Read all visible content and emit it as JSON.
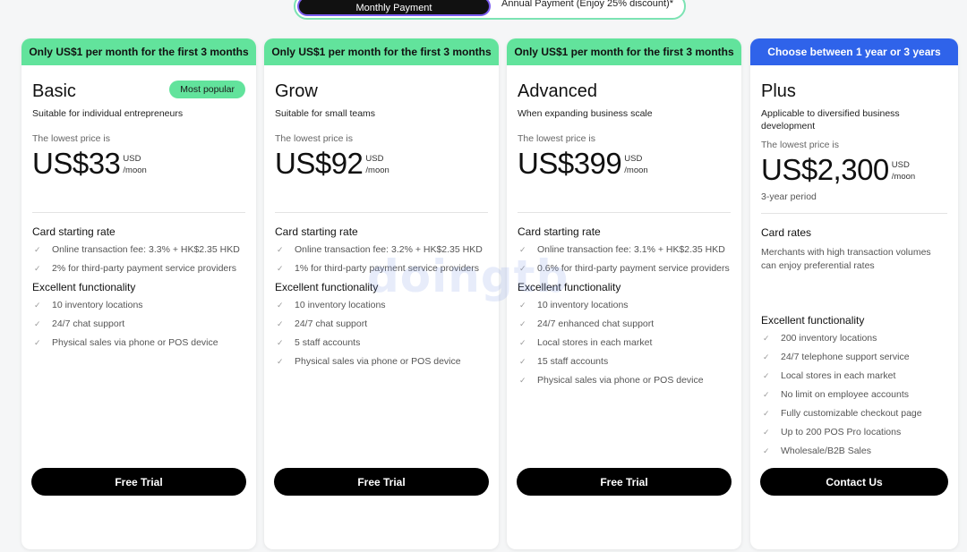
{
  "toggle": {
    "monthly": "Monthly Payment",
    "annual": "Annual Payment (Enjoy 25% discount)*"
  },
  "plans": [
    {
      "banner": "Only US$1 per month for the first 3 months",
      "name": "Basic",
      "badge": "Most popular",
      "desc": "Suitable for individual entrepreneurs",
      "lowest": "The lowest price is",
      "price": "US$33",
      "unit_a": "USD",
      "unit_b": "/moon",
      "rates_title": "Card starting rate",
      "rates": [
        "Online transaction fee: 3.3% + HK$2.35 HKD",
        "2% for third-party payment service providers"
      ],
      "func_title": "Excellent functionality",
      "features": [
        "10 inventory locations",
        "24/7 chat support",
        "Physical sales via phone or POS device"
      ],
      "button": "Free Trial"
    },
    {
      "banner": "Only US$1 per month for the first 3 months",
      "name": "Grow",
      "desc": "Suitable for small teams",
      "lowest": "The lowest price is",
      "price": "US$92",
      "unit_a": "USD",
      "unit_b": "/moon",
      "rates_title": "Card starting rate",
      "rates": [
        "Online transaction fee: 3.2% + HK$2.35 HKD",
        "1% for third-party payment service providers"
      ],
      "func_title": "Excellent functionality",
      "features": [
        "10 inventory locations",
        "24/7 chat support",
        "5 staff accounts",
        "Physical sales via phone or POS device"
      ],
      "button": "Free Trial"
    },
    {
      "banner": "Only US$1 per month for the first 3 months",
      "name": "Advanced",
      "desc": "When expanding business scale",
      "lowest": "The lowest price is",
      "price": "US$399",
      "unit_a": "USD",
      "unit_b": "/moon",
      "rates_title": "Card starting rate",
      "rates": [
        "Online transaction fee: 3.1% + HK$2.35 HKD",
        "0.6% for third-party payment service providers"
      ],
      "func_title": "Excellent functionality",
      "features": [
        "10 inventory locations",
        "24/7 enhanced chat support",
        "Local stores in each market",
        "15 staff accounts",
        "Physical sales via phone or POS device"
      ],
      "button": "Free Trial"
    },
    {
      "banner": "Choose between 1 year or 3 years",
      "name": "Plus",
      "desc": "Applicable to diversified business development",
      "lowest": "The lowest price is",
      "price": "US$2,300",
      "unit_a": "USD",
      "unit_b": "/moon",
      "period": "3-year period",
      "rates_title": "Card rates",
      "rates_text": "Merchants with high transaction volumes can enjoy preferential rates",
      "func_title": "Excellent functionality",
      "features": [
        "200 inventory locations",
        "24/7 telephone support service",
        "Local stores in each market",
        "No limit on employee accounts",
        "Fully customizable checkout page",
        "Up to 200 POS Pro locations",
        "Wholesale/B2B Sales"
      ],
      "button": "Contact Us"
    }
  ],
  "watermark": "doingtb",
  "colors": {
    "banner_green": "#62e39c",
    "banner_blue": "#2f63ea",
    "button": "#000000"
  }
}
